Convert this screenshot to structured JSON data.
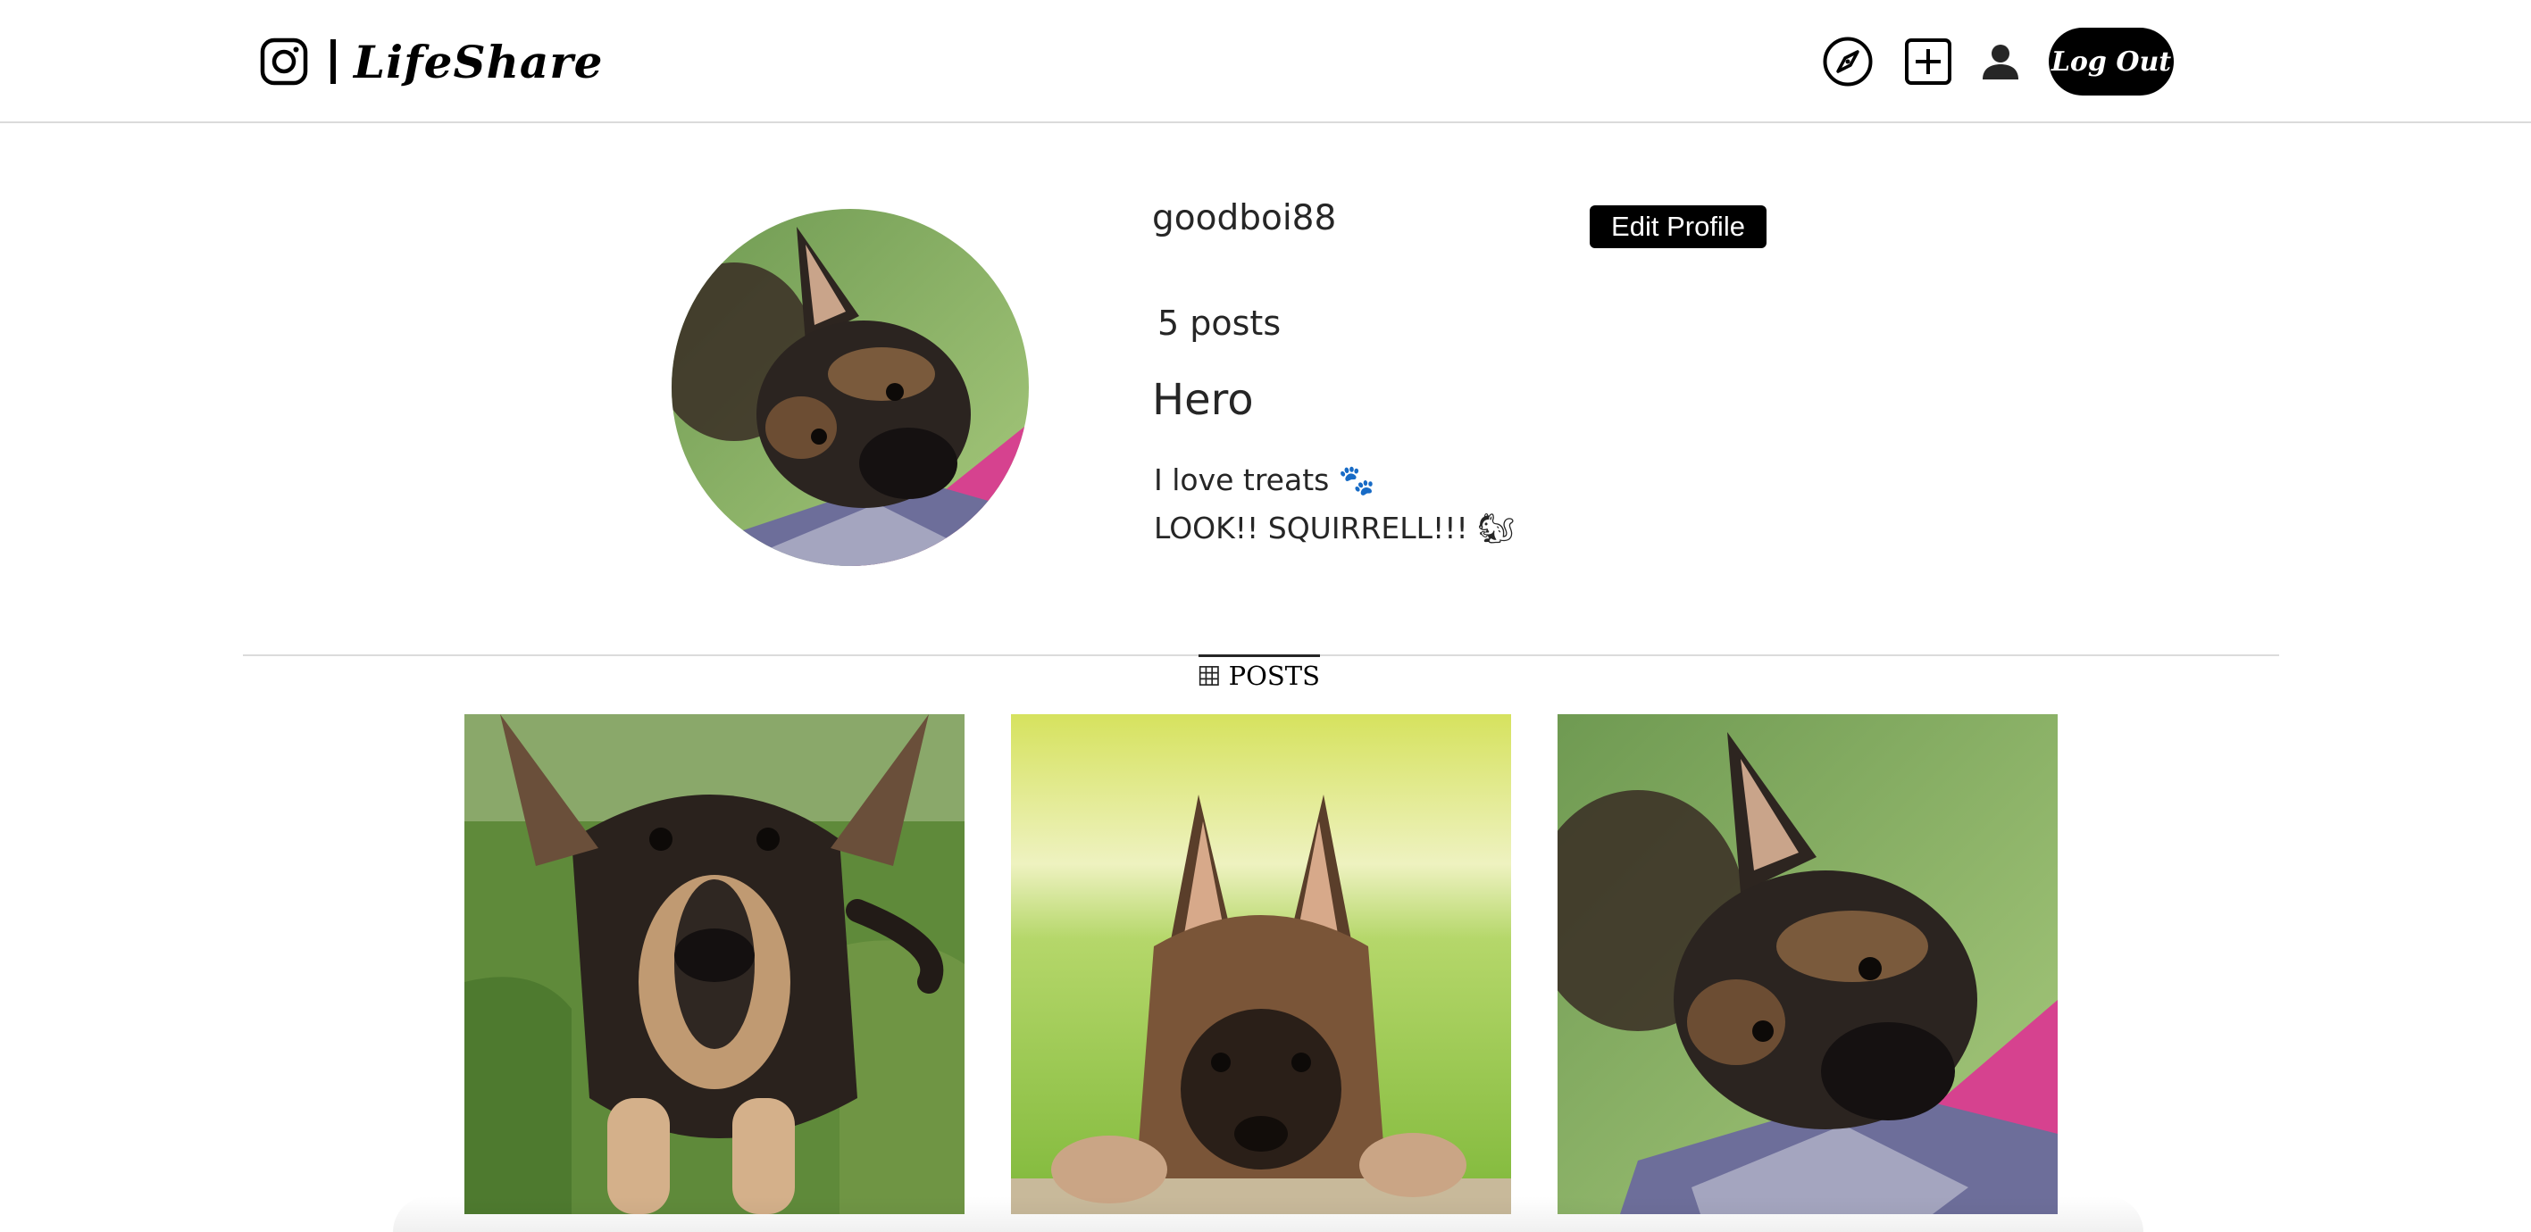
{
  "app": {
    "brand_name": "LifeShare",
    "brand_separator": "|"
  },
  "nav": {
    "icons": [
      "instagram-logo-icon",
      "compass-icon",
      "plus-square-icon",
      "user-icon"
    ],
    "logout_label": "Log Out"
  },
  "profile": {
    "username": "goodboi88",
    "edit_button_label": "Edit Profile",
    "posts_count_text": "5 posts",
    "full_name": "Hero",
    "bio_lines": [
      "I love treats 🐾",
      "LOOK!! SQUIRRELL!!! 🐿"
    ]
  },
  "tabs": {
    "posts_label": "POSTS",
    "posts_icon": "grid-icon"
  },
  "posts": [
    {
      "alt": "german-shepherd-puppy-walking-on-grass"
    },
    {
      "alt": "german-shepherd-puppy-peeking-over-fence"
    },
    {
      "alt": "german-shepherd-puppy-on-pink-blanket"
    }
  ],
  "colors": {
    "accent": "#000000",
    "border": "#dbdbdb",
    "text": "#262626"
  }
}
